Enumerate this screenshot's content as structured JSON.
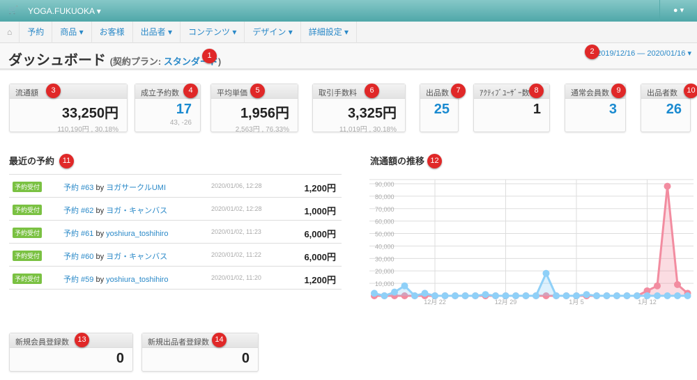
{
  "topbar": {
    "brand": "YOGA.FUKUOKA",
    "cart_icon": "cart-icon",
    "user_icon": "user-icon"
  },
  "nav": {
    "items": [
      "予約",
      "商品 ▾",
      "お客様",
      "出品者 ▾",
      "コンテンツ ▾",
      "デザイン ▾",
      "詳細設定 ▾"
    ]
  },
  "header": {
    "title": "ダッシュボード",
    "plan_prefix": "(契約プラン: ",
    "plan": "スタンダード",
    "plan_suffix": ")",
    "date_range": "2019/12/16 — 2020/01/16 ▾"
  },
  "markers": [
    "1",
    "2",
    "3",
    "4",
    "5",
    "6",
    "7",
    "8",
    "9",
    "10",
    "11",
    "12",
    "13",
    "14"
  ],
  "stats": [
    {
      "label": "流通額",
      "value": "33,250円",
      "sub": "110,190円 , 30.18%"
    },
    {
      "label": "成立予約数",
      "value": "17",
      "sub": "43, -26"
    },
    {
      "label": "平均単価",
      "value": "1,956円",
      "sub": "2,563円 , 76.33%"
    },
    {
      "label": "取引手数料",
      "value": "3,325円",
      "sub": "11,019円 , 30.18%"
    },
    {
      "label": "出品数",
      "value": "25"
    },
    {
      "label": "ｱｸﾃｨﾌﾞﾕｰｻﾞｰ数",
      "value": "1"
    },
    {
      "label": "通常会員数",
      "value": "3"
    },
    {
      "label": "出品者数",
      "value": "26"
    }
  ],
  "recent": {
    "title": "最近の予約",
    "rows": [
      {
        "status": "予約受付",
        "link": "予約 #63",
        "by": "by",
        "user": "ヨガサークルUMI",
        "date": "2020/01/06, 12:28",
        "amount": "1,200円"
      },
      {
        "status": "予約受付",
        "link": "予約 #62",
        "by": "by",
        "user": "ヨガ・キャンバス",
        "date": "2020/01/02, 12:28",
        "amount": "1,000円"
      },
      {
        "status": "予約受付",
        "link": "予約 #61",
        "by": "by",
        "user": "yoshiura_toshihiro",
        "date": "2020/01/02, 11:23",
        "amount": "6,000円"
      },
      {
        "status": "予約受付",
        "link": "予約 #60",
        "by": "by",
        "user": "ヨガ・キャンバス",
        "date": "2020/01/02, 11:22",
        "amount": "6,000円"
      },
      {
        "status": "予約受付",
        "link": "予約 #59",
        "by": "by",
        "user": "yoshiura_toshihiro",
        "date": "2020/01/02, 11:20",
        "amount": "1,200円"
      }
    ]
  },
  "bottom": [
    {
      "label": "新規会員登録数",
      "value": "0"
    },
    {
      "label": "新規出品者登録数",
      "value": "0"
    }
  ],
  "chart_data": {
    "type": "area",
    "title": "流通額の推移",
    "x_start": "2019-12-16",
    "x_end": "2020-01-16",
    "xticks": [
      {
        "label": "12月 22",
        "index": 6
      },
      {
        "label": "12月 29",
        "index": 13
      },
      {
        "label": "1月 5",
        "index": 20
      },
      {
        "label": "1月 12",
        "index": 27
      }
    ],
    "yticks": [
      "10,000",
      "20,000",
      "30,000",
      "40,000",
      "50,000",
      "60,000",
      "70,000",
      "80,000",
      "90,000"
    ],
    "ylim": [
      0,
      95000
    ],
    "grid": true,
    "series": [
      {
        "color": "#f28ca0",
        "values": [
          0,
          0,
          0,
          0,
          0,
          0,
          0,
          0,
          0,
          0,
          0,
          0,
          0,
          0,
          0,
          0,
          0,
          0,
          0,
          0,
          0,
          0,
          0,
          0,
          0,
          0,
          0,
          4000,
          8000,
          88000,
          9000,
          2000
        ]
      },
      {
        "color": "#8fd0f8",
        "values": [
          2000,
          0,
          3000,
          8000,
          0,
          2000,
          0,
          0,
          0,
          0,
          0,
          1000,
          0,
          0,
          0,
          0,
          0,
          18000,
          0,
          0,
          0,
          1000,
          0,
          0,
          0,
          0,
          0,
          0,
          0,
          0,
          0,
          0
        ]
      }
    ]
  }
}
